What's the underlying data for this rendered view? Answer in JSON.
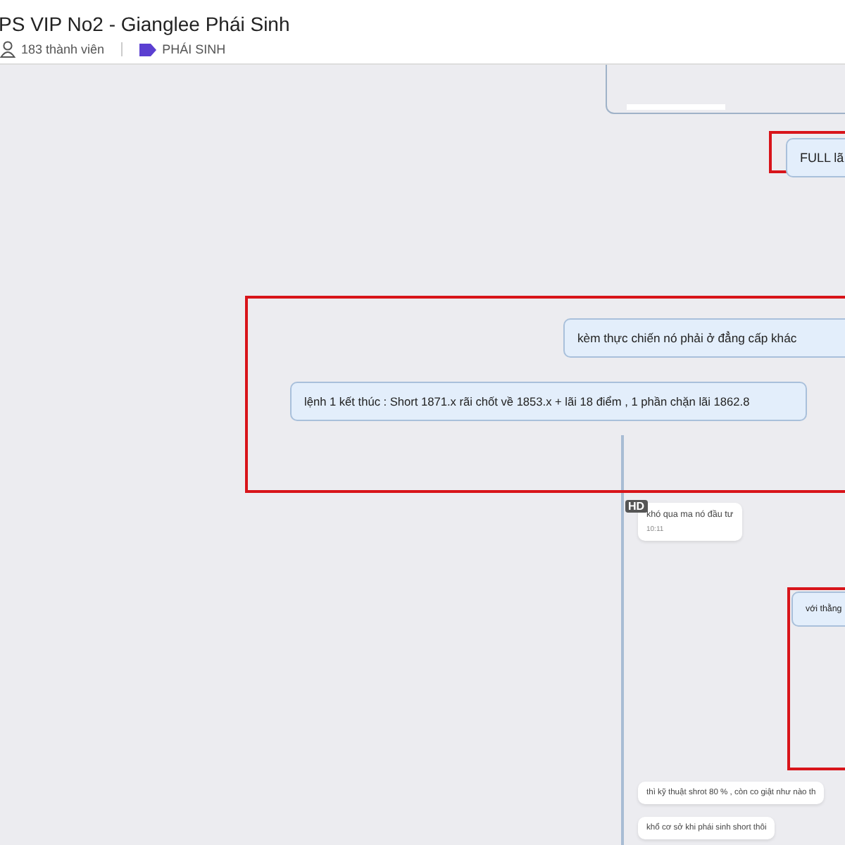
{
  "header": {
    "title": "PS VIP No2 - Gianglee Phái Sinh",
    "members": "183 thành viên",
    "tag": "PHÁI SINH"
  },
  "groups": [
    {
      "highlighted": true,
      "messages": [
        {
          "kind": "outgoing",
          "text": "FULL lã"
        }
      ]
    },
    {
      "highlighted": true,
      "messages": [
        {
          "kind": "outgoing",
          "text": "kèm thực chiến nó phải ở đẳng cấp khác"
        },
        {
          "kind": "outgoing",
          "text": "lệnh 1 kết thúc :  Short 1871.x rãi chốt về 1853.x + lãi 18 điểm , 1 phần chặn lãi 1862.8"
        }
      ]
    },
    {
      "highlighted": false,
      "messages": [
        {
          "kind": "incoming",
          "text": "khó qua ma nó đầu tư",
          "time": "10:11",
          "badge": "HD"
        }
      ]
    },
    {
      "highlighted": true,
      "messages": [
        {
          "kind": "outgoing",
          "text": "với thằng"
        }
      ]
    },
    {
      "highlighted": false,
      "messages": [
        {
          "kind": "incoming",
          "text": "thì kỹ thuật shrot 80 % , còn co giật như nào th"
        },
        {
          "kind": "incoming",
          "text": "khổ cơ sở khi phái sinh short thôi"
        }
      ]
    }
  ]
}
